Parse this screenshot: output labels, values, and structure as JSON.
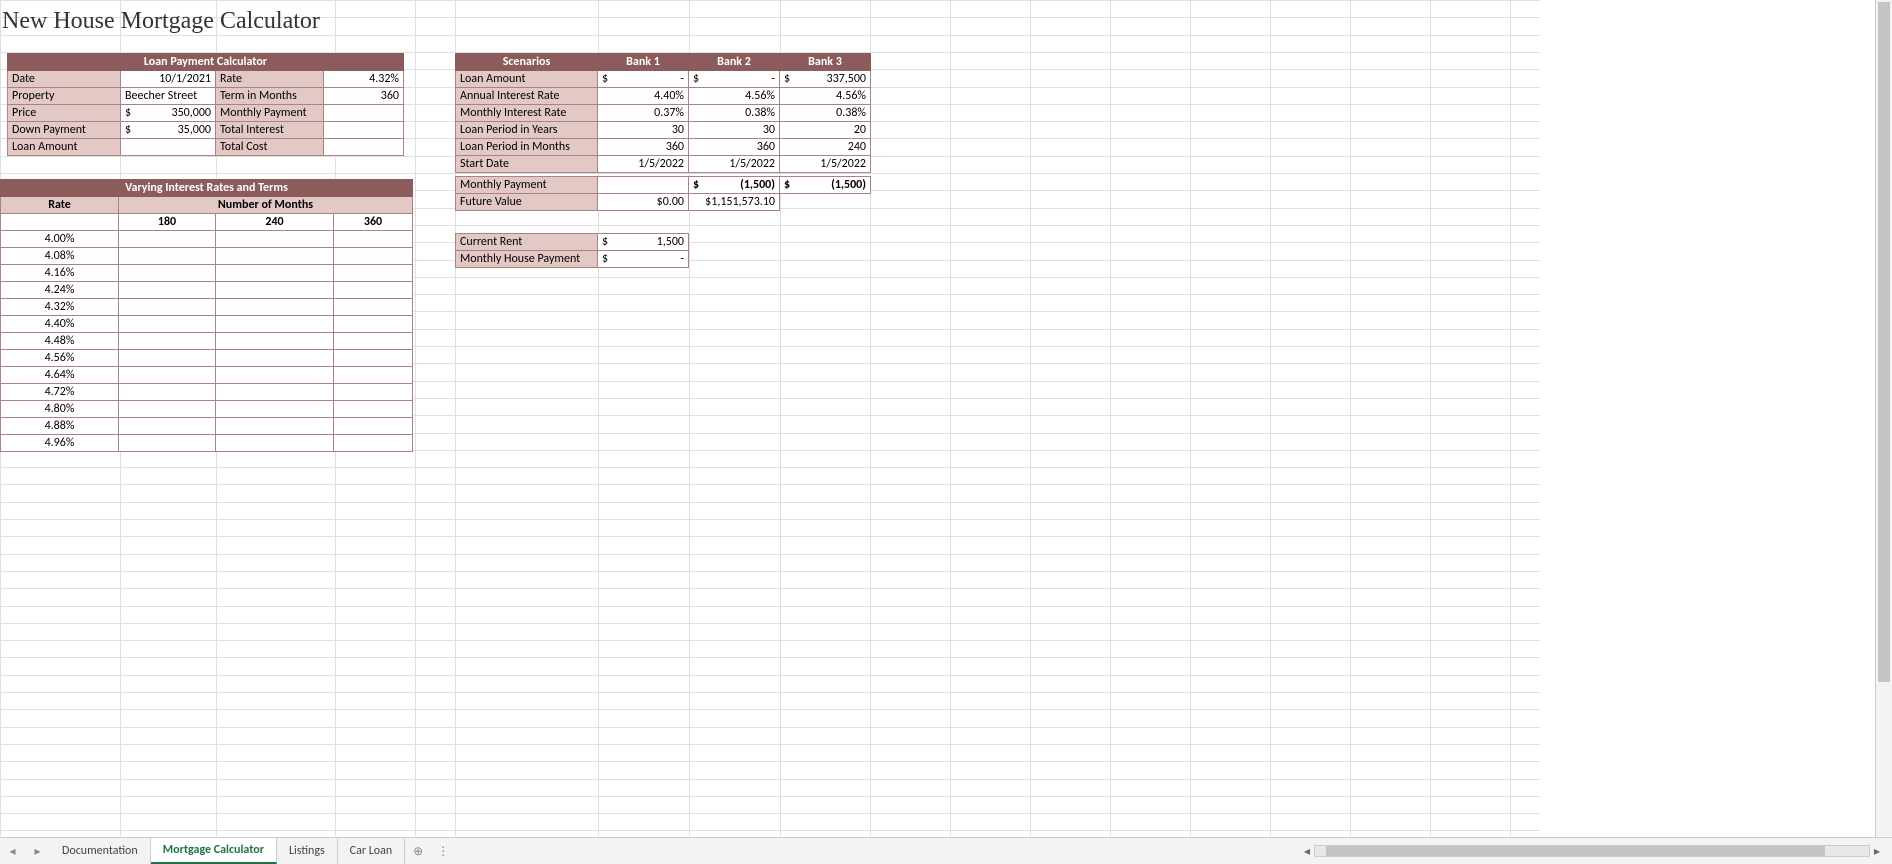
{
  "title": "New House Mortgage Calculator",
  "loanCalc": {
    "header": "Loan Payment Calculator",
    "rows": {
      "date_l": "Date",
      "date_v": "10/1/2021",
      "rate_l": "Rate",
      "rate_v": "4.32%",
      "prop_l": "Property",
      "prop_v": "Beecher Street",
      "term_l": "Term in Months",
      "term_v": "360",
      "price_l": "Price",
      "price_c": "$",
      "price_v": "350,000",
      "mpay_l": "Monthly Payment",
      "down_l": "Down Payment",
      "down_c": "$",
      "down_v": "35,000",
      "tint_l": "Total Interest",
      "lamt_l": "Loan Amount",
      "tcost_l": "Total Cost"
    }
  },
  "vary": {
    "header": "Varying Interest Rates and Terms",
    "rateLabel": "Rate",
    "monthsLabel": "Number of Months",
    "cols": [
      "180",
      "240",
      "360"
    ],
    "rates": [
      "4.00%",
      "4.08%",
      "4.16%",
      "4.24%",
      "4.32%",
      "4.40%",
      "4.48%",
      "4.56%",
      "4.64%",
      "4.72%",
      "4.80%",
      "4.88%",
      "4.96%"
    ]
  },
  "scen": {
    "header": "Scenarios",
    "banks": [
      "Bank 1",
      "Bank 2",
      "Bank 3"
    ],
    "rows": [
      {
        "l": "Loan Amount",
        "v": [
          {
            "c": "$",
            "t": "-"
          },
          {
            "c": "$",
            "t": "-"
          },
          {
            "c": "$",
            "t": "337,500"
          }
        ]
      },
      {
        "l": "Annual Interest Rate",
        "v": [
          "4.40%",
          "4.56%",
          "4.56%"
        ]
      },
      {
        "l": "Monthly Interest Rate",
        "v": [
          "0.37%",
          "0.38%",
          "0.38%"
        ]
      },
      {
        "l": "Loan Period in Years",
        "v": [
          "30",
          "30",
          "20"
        ]
      },
      {
        "l": "Loan Period in Months",
        "v": [
          "360",
          "360",
          "240"
        ]
      },
      {
        "l": "Start Date",
        "v": [
          "1/5/2022",
          "1/5/2022",
          "1/5/2022"
        ]
      }
    ],
    "mpay_l": "Monthly Payment",
    "mpay_v": [
      "",
      {
        "c": "$",
        "t": "(1,500)"
      },
      {
        "c": "$",
        "t": "(1,500)"
      }
    ],
    "fv_l": "Future Value",
    "fv_v": [
      "$0.00",
      "$1,151,573.10",
      ""
    ]
  },
  "extra": {
    "rent_l": "Current Rent",
    "rent_c": "$",
    "rent_v": "1,500",
    "house_l": "Monthly House Payment",
    "house_c": "$",
    "house_v": "-"
  },
  "tabs": [
    "Documentation",
    "Mortgage Calculator",
    "Listings",
    "Car Loan"
  ],
  "activeTab": 1
}
